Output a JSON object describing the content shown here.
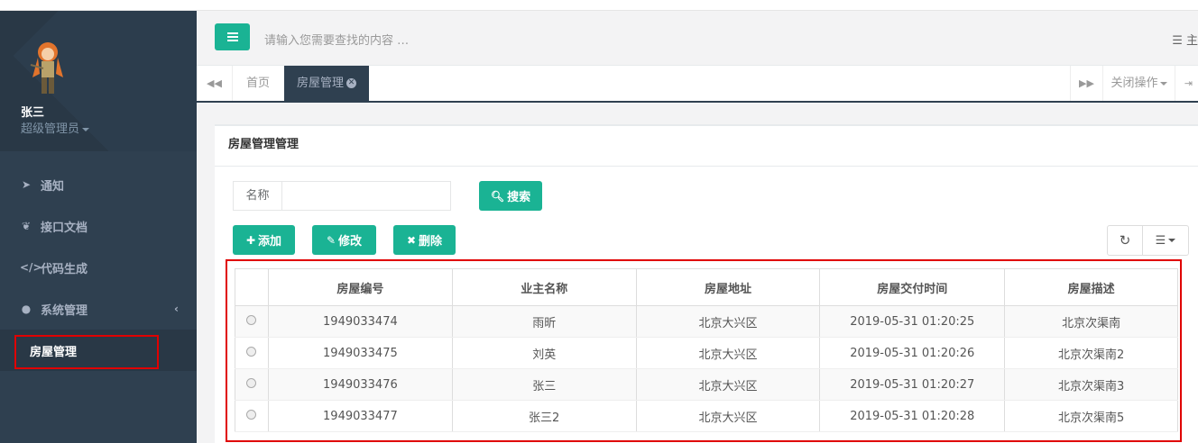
{
  "sidebar": {
    "user_name": "张三",
    "user_role": "超级管理员",
    "items": [
      {
        "label": "通知",
        "icon": "paper-plane-icon"
      },
      {
        "label": "接口文档",
        "icon": "leaf-icon"
      },
      {
        "label": "代码生成",
        "icon": "code-icon"
      },
      {
        "label": "系统管理",
        "icon": "user-icon"
      }
    ],
    "sub_item": "房屋管理",
    "arrow": "‹"
  },
  "topbar": {
    "search_placeholder": "请输入您需要查找的内容 …",
    "theme_label": "主"
  },
  "tabs": {
    "home": "首页",
    "active": "房屋管理",
    "close_ops": "关闭操作"
  },
  "panel": {
    "title": "房屋管理管理",
    "search_label": "名称",
    "search_value": "",
    "search_button": "搜索",
    "add_button": "添加",
    "edit_button": "修改",
    "delete_button": "删除"
  },
  "table": {
    "headers": [
      "房屋编号",
      "业主名称",
      "房屋地址",
      "房屋交付时间",
      "房屋描述"
    ],
    "rows": [
      [
        "1949033474",
        "雨昕",
        "北京大兴区",
        "2019-05-31 01:20:25",
        "北京次渠南"
      ],
      [
        "1949033475",
        "刘英",
        "北京大兴区",
        "2019-05-31 01:20:26",
        "北京次渠南2"
      ],
      [
        "1949033476",
        "张三",
        "北京大兴区",
        "2019-05-31 01:20:27",
        "北京次渠南3"
      ],
      [
        "1949033477",
        "张三2",
        "北京大兴区",
        "2019-05-31 01:20:28",
        "北京次渠南5"
      ]
    ]
  },
  "colors": {
    "accent": "#1ab394",
    "sidebar": "#2f4050",
    "highlight": "#e00000"
  }
}
